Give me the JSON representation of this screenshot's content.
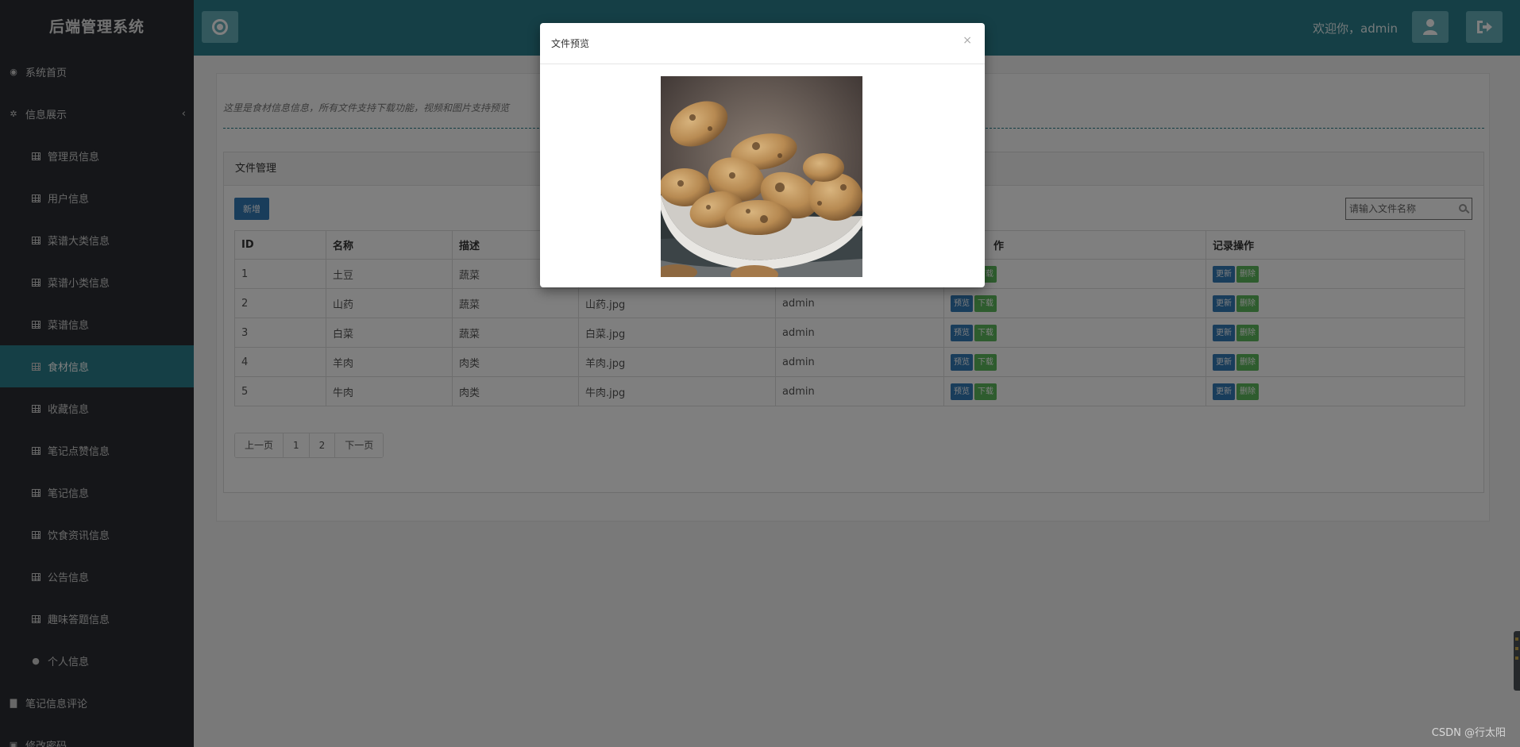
{
  "sidebar": {
    "brand": "后端管理系统",
    "items": [
      {
        "label": "系统首页"
      },
      {
        "label": "信息展示",
        "caret": "‹"
      },
      {
        "label": "管理员信息"
      },
      {
        "label": "用户信息"
      },
      {
        "label": "菜谱大类信息"
      },
      {
        "label": "菜谱小类信息"
      },
      {
        "label": "菜谱信息"
      },
      {
        "label": "食材信息"
      },
      {
        "label": "收藏信息"
      },
      {
        "label": "笔记点赞信息"
      },
      {
        "label": "笔记信息"
      },
      {
        "label": "饮食资讯信息"
      },
      {
        "label": "公告信息"
      },
      {
        "label": "趣味答题信息"
      },
      {
        "label": "个人信息"
      },
      {
        "label": "笔记信息评论"
      },
      {
        "label": "修改密码"
      }
    ]
  },
  "header": {
    "welcome": "欢迎你，admin"
  },
  "main": {
    "notice": "这里是食材信息信息，所有文件支持下载功能，视频和图片支持预览",
    "box_title": "文件管理",
    "add_label": "新增",
    "search_placeholder": "请输入文件名称",
    "columns": [
      "ID",
      "名称",
      "描述",
      "",
      "",
      "作",
      "记录操作"
    ],
    "rows": [
      {
        "id": "1",
        "name": "土豆",
        "desc": "蔬菜",
        "file": "",
        "owner": ""
      },
      {
        "id": "2",
        "name": "山药",
        "desc": "蔬菜",
        "file": "山药.jpg",
        "owner": "admin"
      },
      {
        "id": "3",
        "name": "白菜",
        "desc": "蔬菜",
        "file": "白菜.jpg",
        "owner": "admin"
      },
      {
        "id": "4",
        "name": "羊肉",
        "desc": "肉类",
        "file": "羊肉.jpg",
        "owner": "admin"
      },
      {
        "id": "5",
        "name": "牛肉",
        "desc": "肉类",
        "file": "牛肉.jpg",
        "owner": "admin"
      }
    ],
    "row_actions": {
      "preview": "预览",
      "download": "下载",
      "update": "更新",
      "delete": "删除"
    },
    "pager": {
      "prev": "上一页",
      "pages": [
        "1",
        "2"
      ],
      "next": "下一页"
    }
  },
  "modal": {
    "title": "文件预览",
    "close": "×"
  },
  "watermark": "CSDN @行太阳",
  "colors": {
    "sidebar": "#2a2d33",
    "header": "#2b7f8c",
    "active": "#2b7f8c",
    "primary": "#337ab7",
    "success": "#5cb85c"
  }
}
